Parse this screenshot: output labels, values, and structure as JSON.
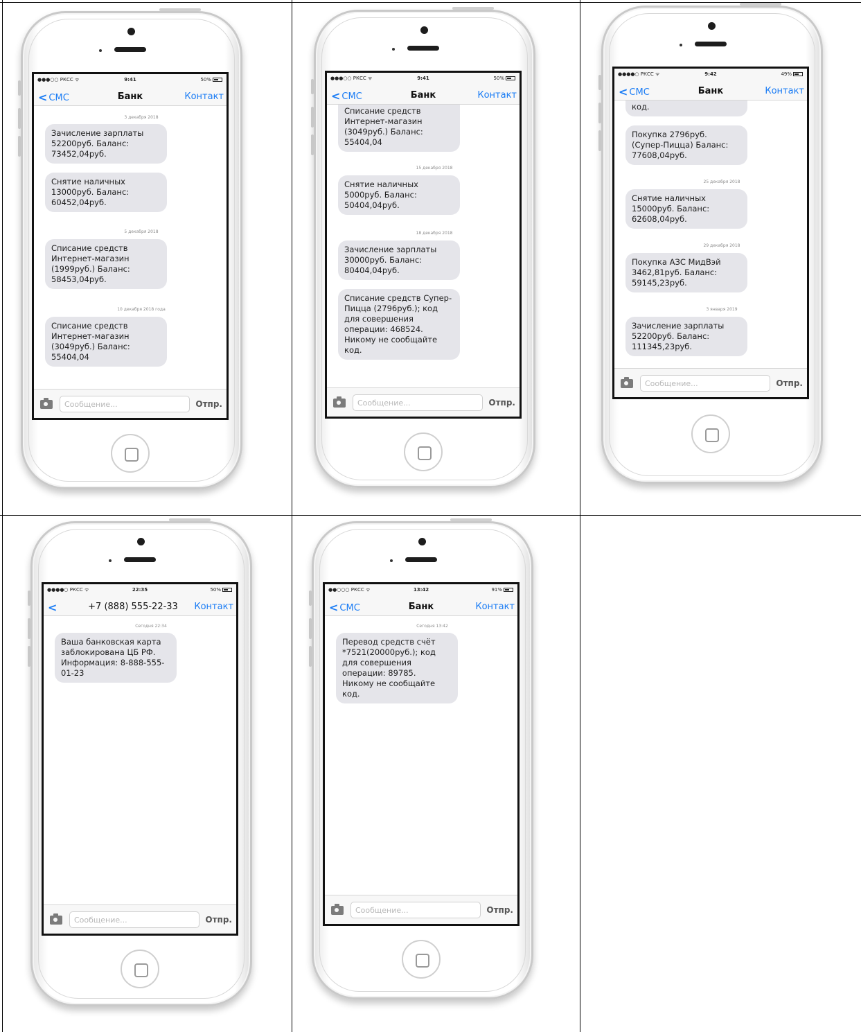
{
  "phones": [
    {
      "status": {
        "carrier": "●●●○○ РКСС ᯤ",
        "time": "9:41",
        "battery": "50%"
      },
      "nav": {
        "back": "СМС",
        "title": "Банк",
        "right": "Контакт"
      },
      "items": [
        {
          "kind": "date",
          "text": "3 декабря 2018"
        },
        {
          "kind": "bubble",
          "text": "Зачисление зарплаты\n52200руб. Баланс:\n73452,04руб."
        },
        {
          "kind": "bubble",
          "text": "Снятие наличных\n13000руб. Баланс:\n60452,04руб."
        },
        {
          "kind": "date",
          "text": "5 декабря 2018"
        },
        {
          "kind": "bubble",
          "text": "Списание средств\nИнтернет-магазин\n(1999руб.) Баланс:\n58453,04руб."
        },
        {
          "kind": "date",
          "text": "10 декабря 2018 года"
        },
        {
          "kind": "bubble",
          "text": "Списание средств\nИнтернет-магазин\n(3049руб.) Баланс:\n55404,04"
        }
      ],
      "input": {
        "placeholder": "Сообщение...",
        "send": "Отпр."
      }
    },
    {
      "status": {
        "carrier": "●●●○○ РКСС ᯤ",
        "time": "9:41",
        "battery": "50%"
      },
      "nav": {
        "back": "СМС",
        "title": "Банк",
        "right": "Контакт"
      },
      "items": [
        {
          "kind": "bubble",
          "text": "Списание средств\nИнтернет-магазин\n(3049руб.) Баланс:\n55404,04"
        },
        {
          "kind": "date",
          "text": "15 декабря 2018"
        },
        {
          "kind": "bubble",
          "text": "Снятие наличных\n5000руб. Баланс:\n50404,04руб."
        },
        {
          "kind": "date",
          "text": "18 декабря 2018"
        },
        {
          "kind": "bubble",
          "text": "Зачисление зарплаты\n30000руб. Баланс:\n80404,04руб."
        },
        {
          "kind": "bubble",
          "text": "Списание средств Супер-\nПицца (2796руб.); код\nдля совершения\nоперации: 468524.\nНикому не сообщайте\nкод."
        }
      ],
      "input": {
        "placeholder": "Сообщение...",
        "send": "Отпр."
      }
    },
    {
      "status": {
        "carrier": "●●●●○ РКСС ᯤ",
        "time": "9:42",
        "battery": "49%"
      },
      "nav": {
        "back": "СМС",
        "title": "Банк",
        "right": "Контакт"
      },
      "items": [
        {
          "kind": "bubble",
          "text": "код."
        },
        {
          "kind": "bubble",
          "text": "Покупка 2796руб.\n(Супер-Пицца) Баланс:\n77608,04руб."
        },
        {
          "kind": "date",
          "text": "25 декабря 2018"
        },
        {
          "kind": "bubble",
          "text": "Снятие наличных\n15000руб. Баланс:\n62608,04руб."
        },
        {
          "kind": "date",
          "text": "29 декабря 2018"
        },
        {
          "kind": "bubble",
          "text": "Покупка АЗС МидВэй\n3462,81руб. Баланс:\n59145,23руб."
        },
        {
          "kind": "date",
          "text": "3 января 2019"
        },
        {
          "kind": "bubble",
          "text": "Зачисление зарплаты\n52200руб. Баланс:\n111345,23руб."
        }
      ],
      "input": {
        "placeholder": "Сообщение...",
        "send": "Отпр."
      }
    },
    {
      "status": {
        "carrier": "●●●●○ РКСС ᯤ",
        "time": "22:35",
        "battery": "50%"
      },
      "nav": {
        "back": "",
        "title": "+7 (888) 555-22-33",
        "right": "Контакт"
      },
      "items": [
        {
          "kind": "date",
          "text": "Сегодня 22:34"
        },
        {
          "kind": "bubble",
          "text": "Ваша банковская карта\nзаблокирована ЦБ РФ.\nИнформация: 8-888-555-\n01-23"
        }
      ],
      "input": {
        "placeholder": "Сообщение...",
        "send": "Отпр."
      }
    },
    {
      "status": {
        "carrier": "●●○○○ РКСС ᯤ",
        "time": "13:42",
        "battery": "91%"
      },
      "nav": {
        "back": "СМС",
        "title": "Банк",
        "right": "Контакт"
      },
      "items": [
        {
          "kind": "date",
          "text": "Сегодня 13:42"
        },
        {
          "kind": "bubble",
          "text": "Перевод средств счёт\n*7521(20000руб.); код\nдля совершения\nоперации: 89785.\nНикому не сообщайте\nкод."
        }
      ],
      "input": {
        "placeholder": "Сообщение...",
        "send": "Отпр."
      }
    }
  ]
}
